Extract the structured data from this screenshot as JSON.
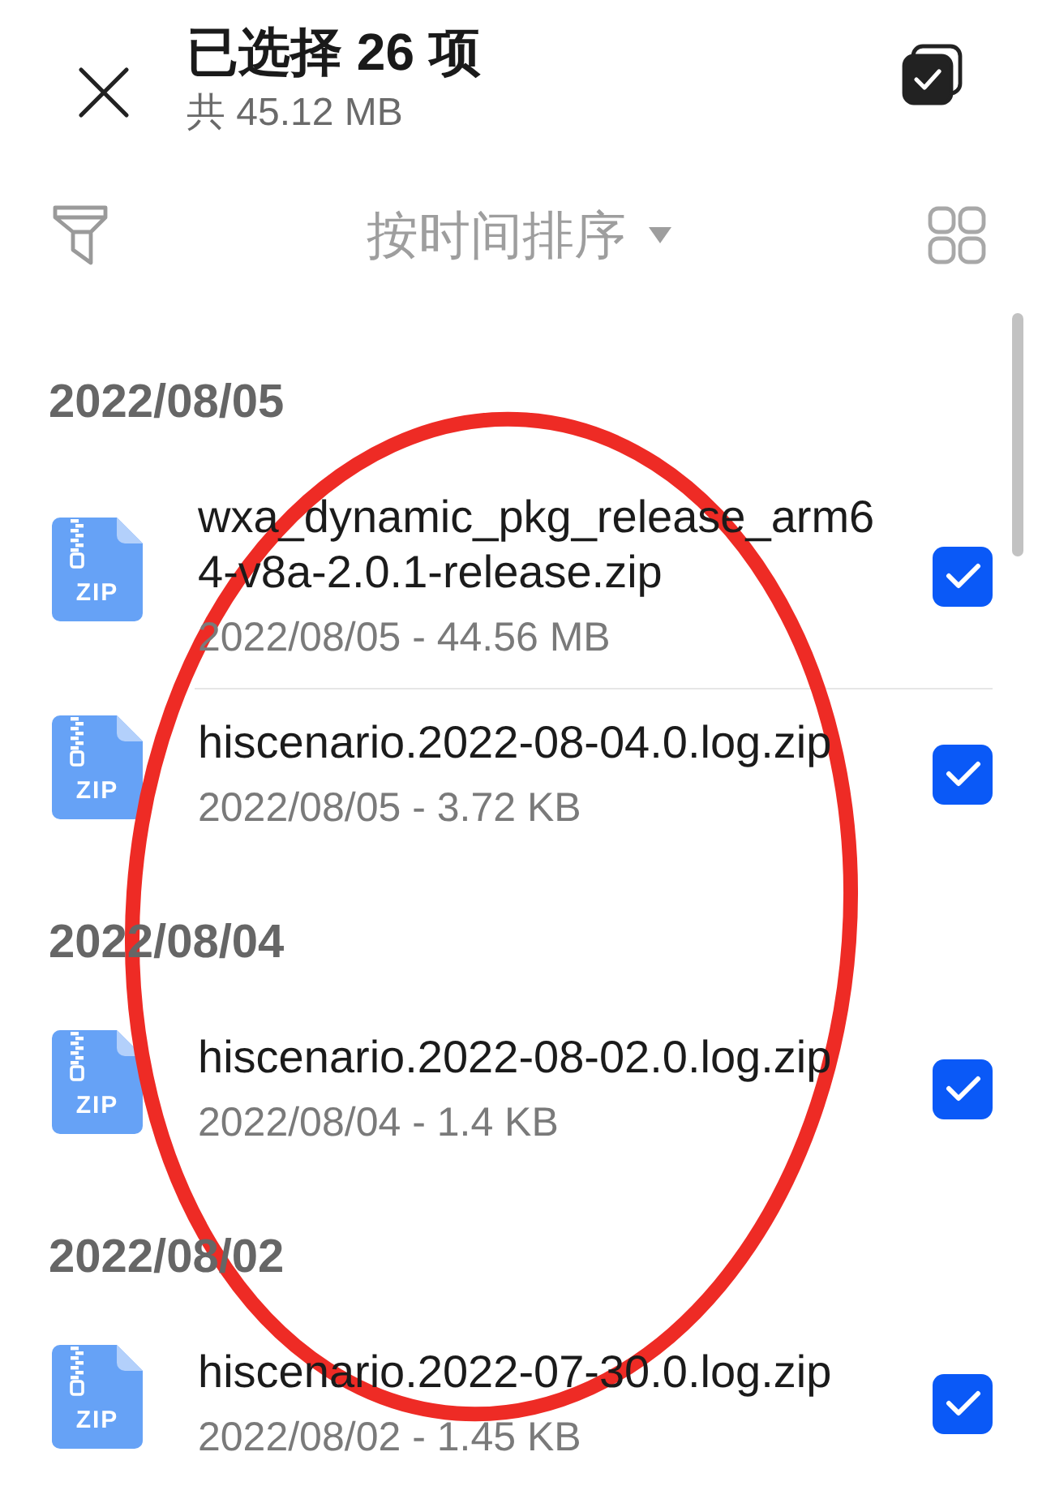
{
  "header": {
    "title": "已选择 26 项",
    "subtitle": "共 45.12 MB",
    "select_all": {
      "checked": true
    }
  },
  "toolbar": {
    "sort_label": "按时间排序"
  },
  "groups": [
    {
      "date": "2022/08/05",
      "files": [
        {
          "name": "wxa_dynamic_pkg_release_arm64-v8a-2.0.1-release.zip",
          "meta": "2022/08/05 - 44.56 MB",
          "type_label": "ZIP",
          "selected": true
        },
        {
          "name": "hiscenario.2022-08-04.0.log.zip",
          "meta": "2022/08/05 - 3.72 KB",
          "type_label": "ZIP",
          "selected": true
        }
      ]
    },
    {
      "date": "2022/08/04",
      "files": [
        {
          "name": "hiscenario.2022-08-02.0.log.zip",
          "meta": "2022/08/04 - 1.4 KB",
          "type_label": "ZIP",
          "selected": true
        }
      ]
    },
    {
      "date": "2022/08/02",
      "files": [
        {
          "name": "hiscenario.2022-07-30.0.log.zip",
          "meta": "2022/08/02 - 1.45 KB",
          "type_label": "ZIP",
          "selected": true
        }
      ]
    }
  ],
  "annotation": {
    "kind": "ellipse"
  }
}
